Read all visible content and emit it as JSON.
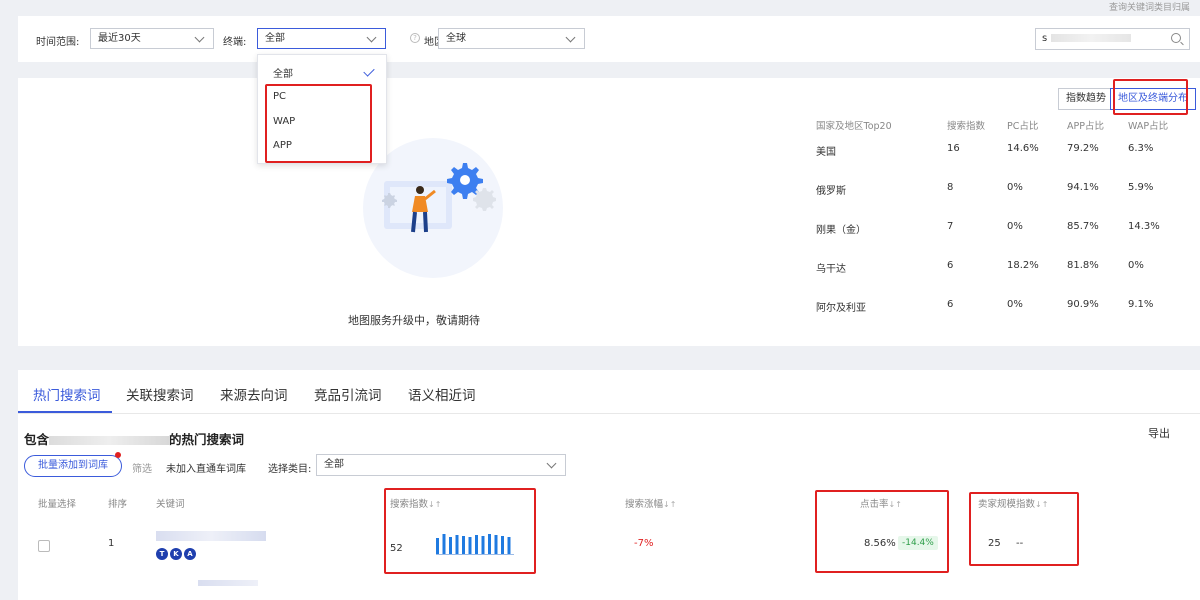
{
  "top_link": "查询关键词类目归属",
  "filters": {
    "time_label": "时间范围:",
    "time_value": "最近30天",
    "terminal_label": "终端:",
    "terminal_value": "全部",
    "region_label": "地区:",
    "region_value": "全球",
    "search_value": "s"
  },
  "dropdown": {
    "options": [
      "全部",
      "PC",
      "WAP",
      "APP"
    ],
    "selected": "全部"
  },
  "map": {
    "message": "地图服务升级中，敬请期待",
    "btn_trend": "指数趋势",
    "btn_dist": "地区及终端分布",
    "headers": [
      "国家及地区Top20",
      "搜索指数",
      "PC占比",
      "APP占比",
      "WAP占比"
    ],
    "rows": [
      [
        "美国",
        "16",
        "14.6%",
        "79.2%",
        "6.3%"
      ],
      [
        "俄罗斯",
        "8",
        "0%",
        "94.1%",
        "5.9%"
      ],
      [
        "刚果（金）",
        "7",
        "0%",
        "85.7%",
        "14.3%"
      ],
      [
        "乌干达",
        "6",
        "18.2%",
        "81.8%",
        "0%"
      ],
      [
        "阿尔及利亚",
        "6",
        "0%",
        "90.9%",
        "9.1%"
      ]
    ]
  },
  "tabs": [
    "热门搜索词",
    "关联搜索词",
    "来源去向词",
    "竞品引流词",
    "语义相近词"
  ],
  "section": {
    "title_prefix": "包含",
    "title_suffix": "的热门搜索词",
    "export": "导出",
    "batch_btn": "批量添加到词库",
    "filter_label": "筛选",
    "not_added": "未加入直通车词库",
    "category_label": "选择类目:",
    "category_value": "全部"
  },
  "table": {
    "headers": [
      "批量选择",
      "排序",
      "关键词",
      "搜索指数",
      "搜索涨幅",
      "点击率",
      "卖家规模指数"
    ],
    "row": {
      "rank": "1",
      "tags": [
        "T",
        "K",
        "A"
      ],
      "search_index": "52",
      "search_growth": "-7%",
      "ctr": "8.56%",
      "ctr_change": "-14.4%",
      "seller_index": "25",
      "seller_change": "--"
    },
    "spark_values": [
      0.8,
      1.0,
      0.85,
      0.95,
      0.9,
      0.85,
      0.95,
      0.9,
      1.0,
      0.95,
      0.9,
      0.85
    ]
  },
  "colors": {
    "accent": "#3b5bdb",
    "highlight": "#e02020",
    "spark": "#1f7ae0"
  }
}
